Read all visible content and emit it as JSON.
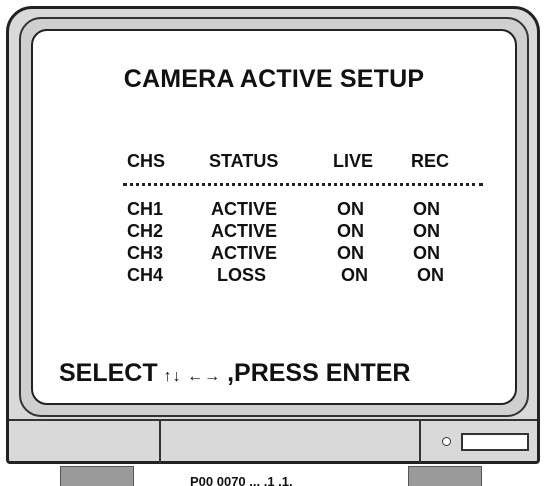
{
  "screen": {
    "title": "CAMERA ACTIVE SETUP",
    "columns": [
      "CHS",
      "STATUS",
      "LIVE",
      "REC"
    ],
    "rows": [
      {
        "chs": "CH1",
        "status": "ACTIVE",
        "live": "ON",
        "rec": "ON"
      },
      {
        "chs": "CH2",
        "status": "ACTIVE",
        "live": "ON",
        "rec": "ON"
      },
      {
        "chs": "CH3",
        "status": "ACTIVE",
        "live": "ON",
        "rec": "ON"
      },
      {
        "chs": "CH4",
        "status": "LOSS",
        "live": "ON",
        "rec": "ON"
      }
    ],
    "footer": {
      "select_label": "SELECT",
      "nav_arrows": "↑↓ ←→",
      "press_label": ",PRESS ENTER"
    }
  },
  "bottom_caption": "P00 0070 ... .1 .1."
}
